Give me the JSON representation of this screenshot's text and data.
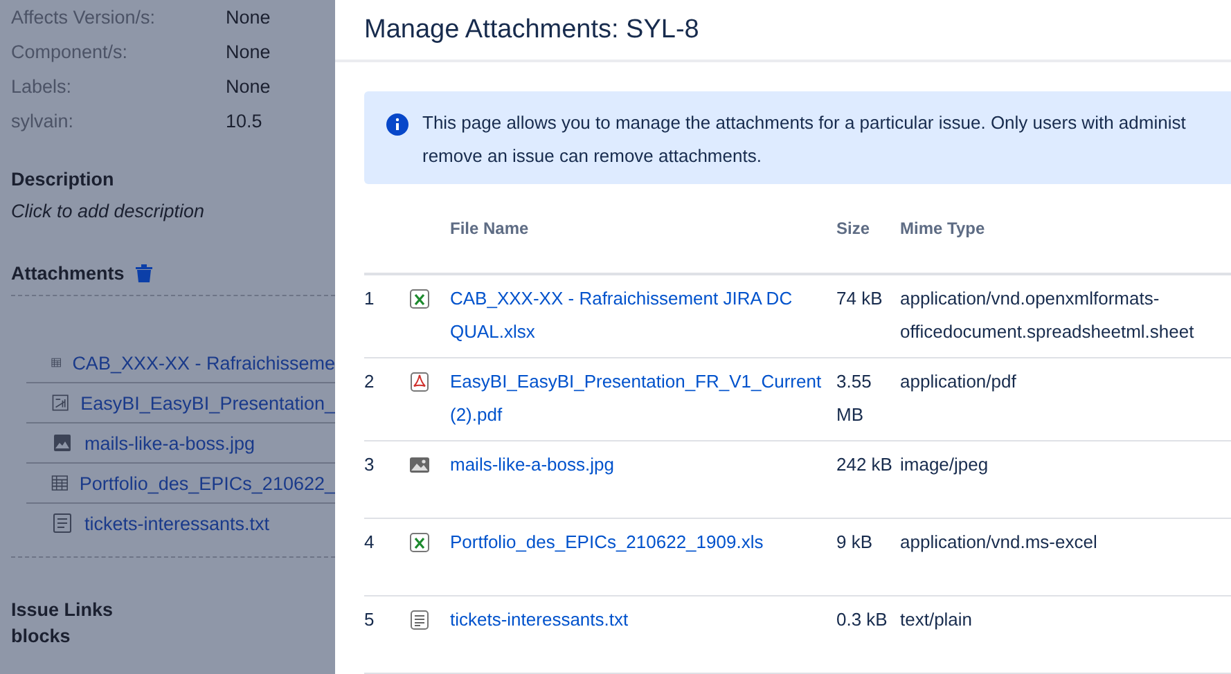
{
  "issue_fields": [
    {
      "label": "Affects Version/s:",
      "value": "None"
    },
    {
      "label": "Component/s:",
      "value": "None"
    },
    {
      "label": "Labels:",
      "value": "None"
    },
    {
      "label": "sylvain:",
      "value": "10.5"
    }
  ],
  "description": {
    "heading": "Description",
    "placeholder": "Click to add description"
  },
  "attachments": {
    "heading": "Attachments",
    "files": [
      {
        "kind": "spreadsheet",
        "name": "CAB_XXX-XX - Rafraichisseme"
      },
      {
        "kind": "pdf",
        "name": "EasyBI_EasyBI_Presentation_"
      },
      {
        "kind": "image",
        "name": "mails-like-a-boss.jpg"
      },
      {
        "kind": "spreadsheet",
        "name": "Portfolio_des_EPICs_210622_"
      },
      {
        "kind": "text",
        "name": "tickets-interessants.txt"
      }
    ]
  },
  "issue_links": {
    "heading": "Issue Links",
    "type": "blocks"
  },
  "modal": {
    "title": "Manage Attachments: SYL-8",
    "banner": {
      "lines": [
        "This page allows you to manage the attachments for a particular issue. Only users with administ",
        "remove an issue can remove attachments."
      ]
    },
    "table": {
      "columns": [
        "File Name",
        "Size",
        "Mime Type"
      ],
      "rows": [
        {
          "index": "1",
          "kind": "excel",
          "name": "CAB_XXX-XX - Rafraichissement JIRA DC QUAL.xlsx",
          "size": "74 kB",
          "mime": "application/vnd.openxmlformats-officedocument.spreadsheetml.sheet"
        },
        {
          "index": "2",
          "kind": "pdf",
          "name": "EasyBI_EasyBI_Presentation_FR_V1_Current (2).pdf",
          "size": "3.55 MB",
          "mime": "application/pdf"
        },
        {
          "index": "3",
          "kind": "image",
          "name": "mails-like-a-boss.jpg",
          "size": "242 kB",
          "mime": "image/jpeg"
        },
        {
          "index": "4",
          "kind": "excel",
          "name": "Portfolio_des_EPICs_210622_1909.xls",
          "size": "9 kB",
          "mime": "application/vnd.ms-excel"
        },
        {
          "index": "5",
          "kind": "text",
          "name": "tickets-interessants.txt",
          "size": "0.3 kB",
          "mime": "text/plain"
        }
      ]
    }
  }
}
